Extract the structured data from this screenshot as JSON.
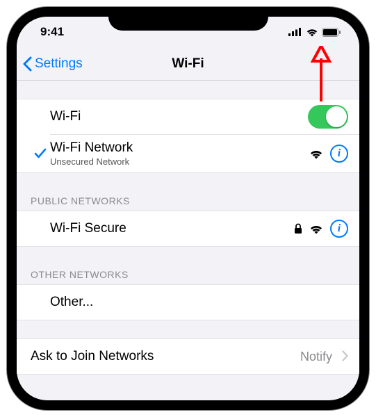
{
  "status": {
    "time": "9:41"
  },
  "nav": {
    "back_label": "Settings",
    "title": "Wi-Fi"
  },
  "main": {
    "wifi_label": "Wi-Fi",
    "wifi_enabled": true,
    "connected": {
      "name": "Wi-Fi Network",
      "subtitle": "Unsecured Network"
    }
  },
  "public": {
    "header": "PUBLIC NETWORKS",
    "items": [
      {
        "name": "Wi-Fi Secure",
        "locked": true
      }
    ]
  },
  "other": {
    "header": "OTHER NETWORKS",
    "other_label": "Other..."
  },
  "join": {
    "label": "Ask to Join Networks",
    "value": "Notify"
  },
  "annotation": {
    "target": "status-wifi-icon",
    "color": "#ff0000"
  }
}
